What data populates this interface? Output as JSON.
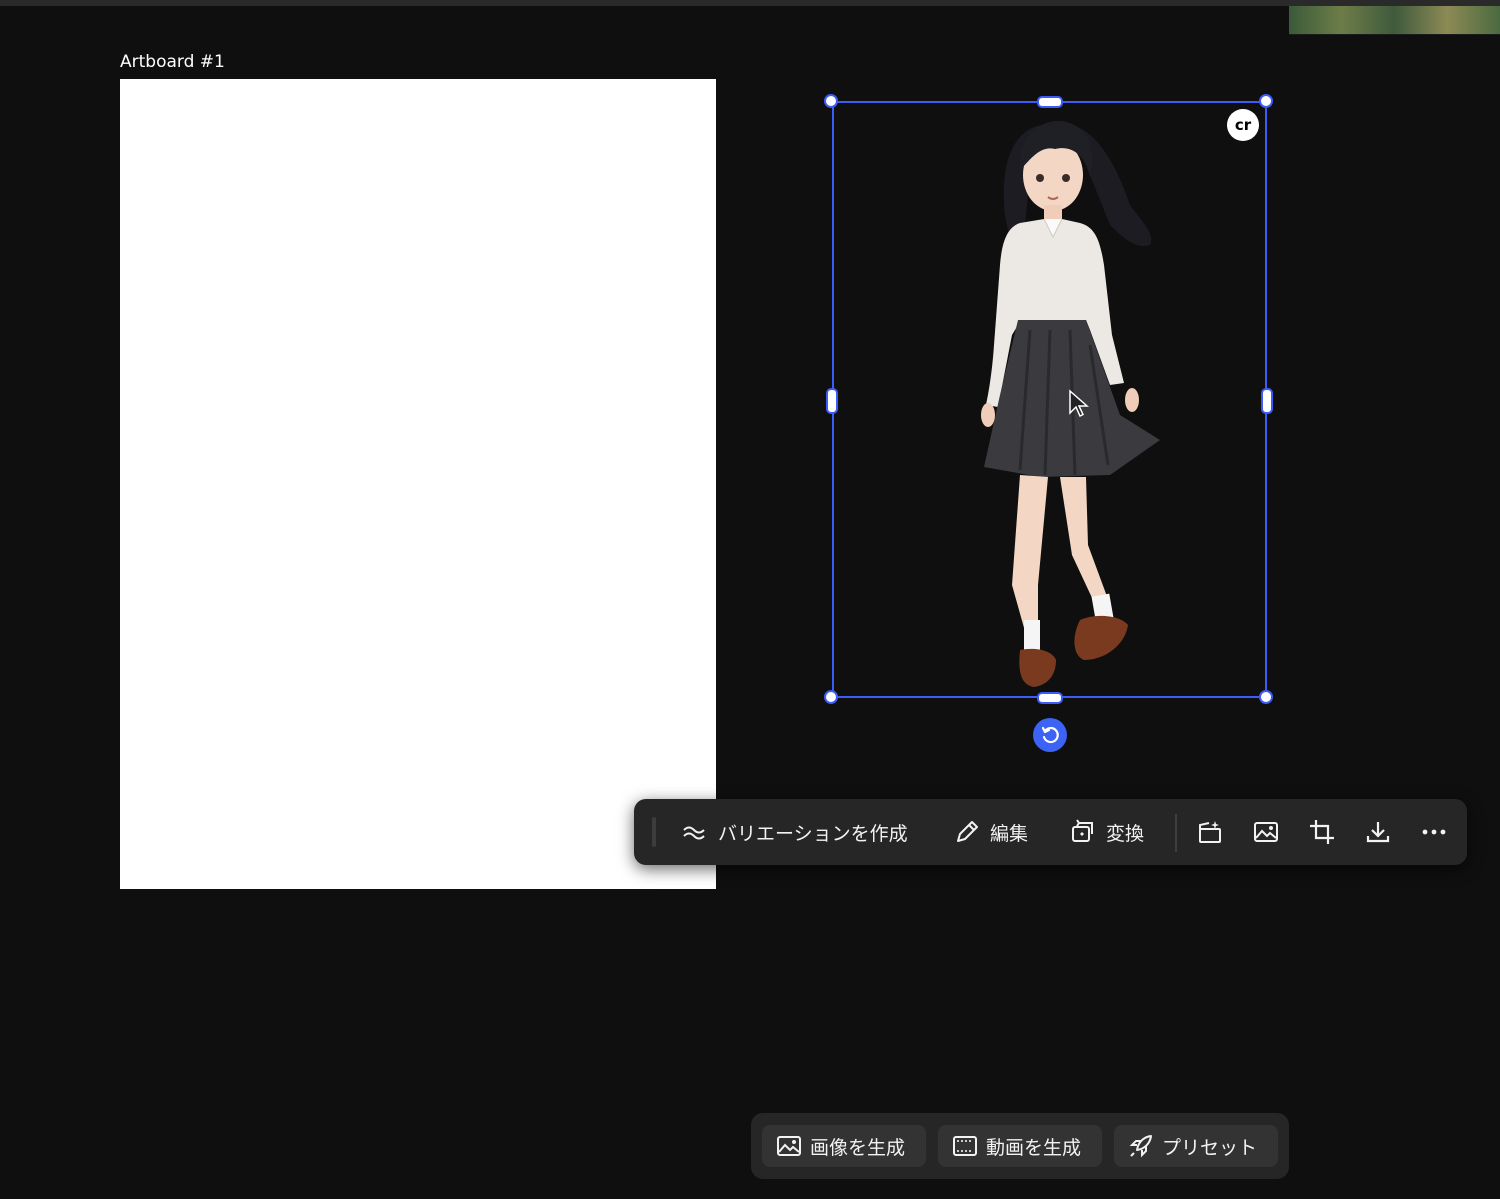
{
  "artboard": {
    "label": "Artboard #1"
  },
  "selection": {
    "badge_text": "cr"
  },
  "toolbar": {
    "variation_label": "バリエーションを作成",
    "edit_label": "編集",
    "convert_label": "変換"
  },
  "bottom_bar": {
    "generate_image_label": "画像を生成",
    "generate_video_label": "動画を生成",
    "preset_label": "プリセット"
  },
  "colors": {
    "selection_accent": "#3d5cf5",
    "canvas_background": "#0f0f0f",
    "toolbar_background": "#262626"
  }
}
